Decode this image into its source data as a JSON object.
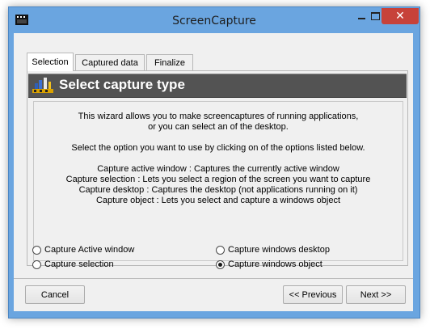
{
  "window": {
    "title": "ScreenCapture",
    "controls": {
      "close_label": "✕"
    }
  },
  "tabs": [
    {
      "label": "Selection",
      "active": true
    },
    {
      "label": "Captured data",
      "active": false
    },
    {
      "label": "Finalize",
      "active": false
    }
  ],
  "header": {
    "title": "Select capture type"
  },
  "description": {
    "lines": [
      "This wizard allows you to make screencaptures of running applications,",
      "or you can select an of the desktop.",
      "Select the option you want to use by clicking on of the options listed below.",
      "Capture active window : Captures the currently active window",
      "Capture selection : Lets you select a region of the screen you want to capture",
      "Capture desktop : Captures the desktop (not applications running on it)",
      "Capture object : Lets you select and capture a windows object"
    ]
  },
  "options": [
    {
      "label": "Capture Active window",
      "selected": false
    },
    {
      "label": "Capture selection",
      "selected": false
    },
    {
      "label": "Capture windows desktop",
      "selected": false
    },
    {
      "label": "Capture windows object",
      "selected": true
    }
  ],
  "buttons": {
    "cancel": "Cancel",
    "previous": "<< Previous",
    "next": "Next >>"
  },
  "colors": {
    "frame": "#6aa5e0",
    "close_button": "#c7423a",
    "header_band": "#535353"
  }
}
